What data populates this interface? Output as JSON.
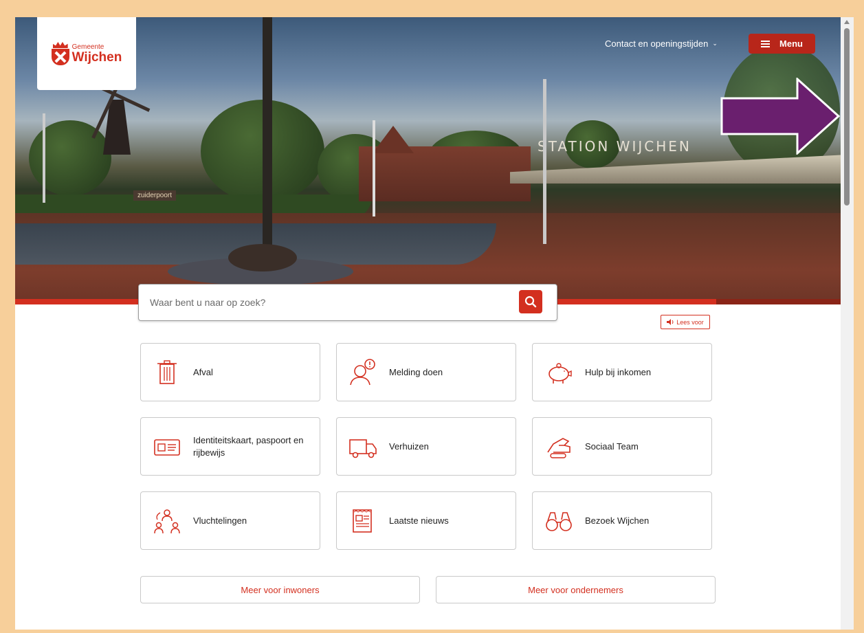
{
  "header": {
    "logo": {
      "line1": "Gemeente",
      "line2": "Wijchen"
    },
    "contact_label": "Contact en openingstijden",
    "menu_label": "Menu"
  },
  "hero": {
    "signs": [
      "zuiderpoort",
      "STATION WIJCHEN"
    ]
  },
  "search": {
    "placeholder": "Waar bent u naar op zoek?"
  },
  "read_aloud": {
    "label": "Lees voor"
  },
  "tiles": [
    {
      "label": "Afval",
      "icon": "trash-icon"
    },
    {
      "label": "Melding doen",
      "icon": "person-alert-icon"
    },
    {
      "label": "Hulp bij inkomen",
      "icon": "piggy-bank-icon"
    },
    {
      "label": "Identiteitskaart, paspoort en rijbewijs",
      "icon": "id-card-icon"
    },
    {
      "label": "Verhuizen",
      "icon": "moving-truck-icon"
    },
    {
      "label": "Sociaal Team",
      "icon": "handshake-icon"
    },
    {
      "label": "Vluchtelingen",
      "icon": "refugees-icon"
    },
    {
      "label": "Laatste nieuws",
      "icon": "newspaper-icon"
    },
    {
      "label": "Bezoek Wijchen",
      "icon": "binoculars-icon"
    }
  ],
  "more_links": [
    {
      "label": "Meer voor inwoners"
    },
    {
      "label": "Meer voor ondernemers"
    }
  ],
  "colors": {
    "brand_red": "#d32f1f",
    "annotation_arrow": "#6a1f6e",
    "frame": "#f7cf9a"
  }
}
